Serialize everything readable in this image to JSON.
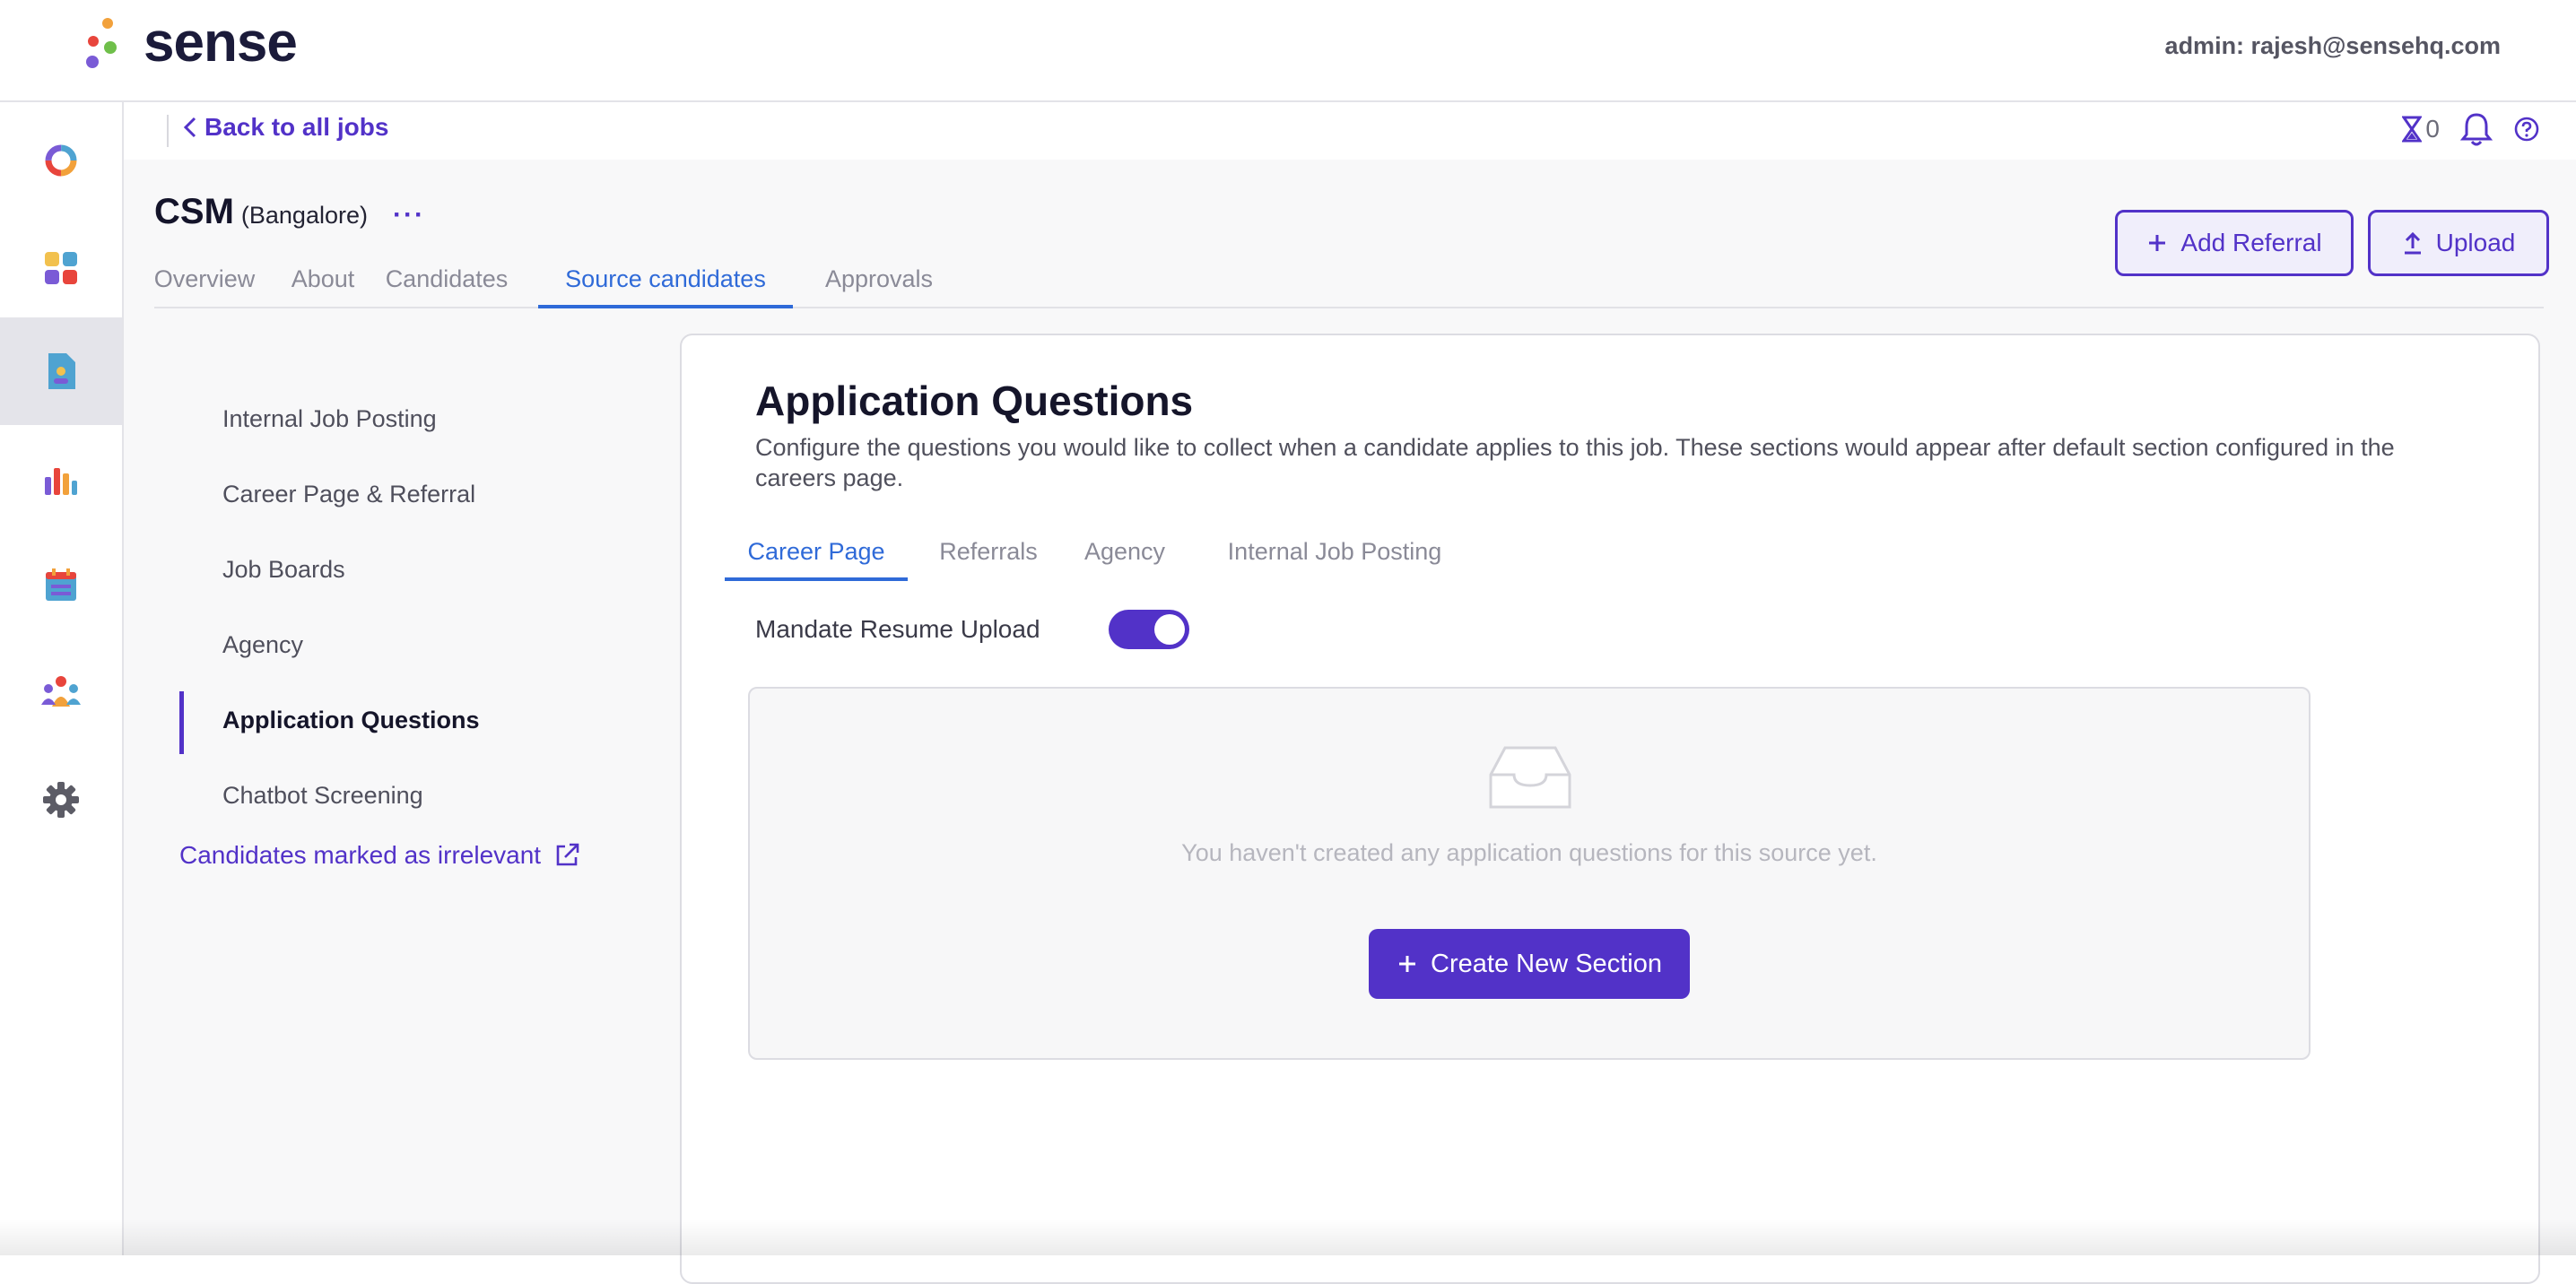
{
  "app": {
    "logo_text": "sense",
    "admin_label": "admin: rajesh@sensehq.com"
  },
  "rail": {
    "items": [
      {
        "icon": "dashboard-ring-icon"
      },
      {
        "icon": "apps-grid-icon"
      },
      {
        "icon": "job-document-icon",
        "active": true
      },
      {
        "icon": "analytics-bars-icon"
      },
      {
        "icon": "calendar-icon"
      },
      {
        "icon": "people-group-icon"
      },
      {
        "icon": "settings-gear-icon"
      }
    ]
  },
  "subbar": {
    "back_label": "Back to all jobs",
    "hourglass_count": "0"
  },
  "job": {
    "name": "CSM",
    "location": "(Bangalore)",
    "more": "···"
  },
  "tabs": [
    {
      "label": "Overview"
    },
    {
      "label": "About"
    },
    {
      "label": "Candidates"
    },
    {
      "label": "Source candidates",
      "active": true
    },
    {
      "label": "Approvals"
    }
  ],
  "actions": {
    "add_referral": "Add Referral",
    "upload": "Upload"
  },
  "side_nav": {
    "items": [
      {
        "label": "Internal Job Posting"
      },
      {
        "label": "Career Page & Referral"
      },
      {
        "label": "Job Boards"
      },
      {
        "label": "Agency"
      },
      {
        "label": "Application Questions",
        "active": true
      },
      {
        "label": "Chatbot Screening"
      }
    ],
    "irrelevant_link": "Candidates marked as irrelevant"
  },
  "card": {
    "title": "Application Questions",
    "description": "Configure the questions you would like to collect when a candidate applies to this job. These sections would appear after default section configured in the careers page.",
    "tabs": [
      {
        "label": "Career Page",
        "active": true
      },
      {
        "label": "Referrals"
      },
      {
        "label": "Agency"
      },
      {
        "label": "Internal Job Posting"
      }
    ],
    "mandate_label": "Mandate Resume Upload",
    "mandate_on": true,
    "empty_text": "You haven't created any application questions for this source yet.",
    "create_button": "Create New Section"
  },
  "colors": {
    "accent": "#5232c8",
    "tab_active": "#2f6ad8",
    "bg": "#f8f8f9"
  }
}
